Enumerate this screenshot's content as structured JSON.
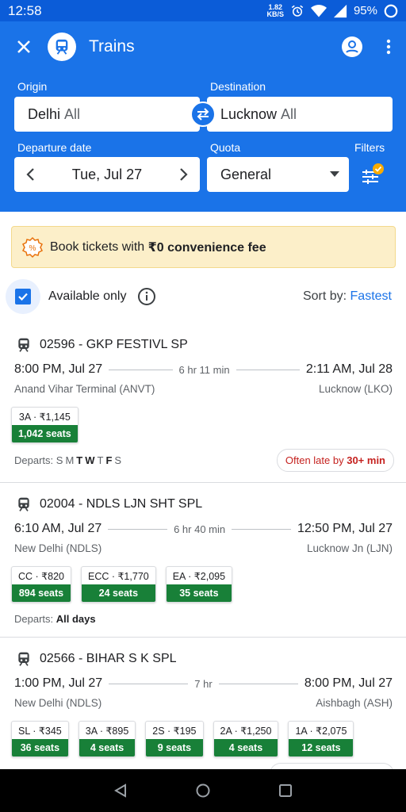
{
  "status_bar": {
    "time": "12:58",
    "net_speed": "1.82",
    "net_unit": "KB/S",
    "battery": "95%"
  },
  "app_bar": {
    "title": "Trains",
    "icons": [
      "close-icon",
      "train-icon",
      "account-icon",
      "more-vert-icon"
    ]
  },
  "search": {
    "origin_label": "Origin",
    "origin_value": "Delhi",
    "origin_suffix": "All",
    "destination_label": "Destination",
    "destination_value": "Lucknow",
    "destination_suffix": "All",
    "date_label": "Departure date",
    "date_value": "Tue, Jul 27",
    "quota_label": "Quota",
    "quota_value": "General",
    "filters_label": "Filters"
  },
  "banner": {
    "prefix": "Book tickets with ",
    "highlight": "₹0 convenience fee"
  },
  "filter_row": {
    "available_only": "Available only",
    "sort_label": "Sort by:",
    "sort_value": "Fastest"
  },
  "trains": [
    {
      "name": "02596 - GKP FESTIVL SP",
      "dep_time": "8:00 PM, Jul 27",
      "duration": "6 hr 11 min",
      "arr_time": "2:11 AM, Jul 28",
      "from": "Anand Vihar Terminal (ANVT)",
      "to": "Lucknow (LKO)",
      "classes": [
        {
          "fare": "3A · ₹1,145",
          "seats": "1,042 seats"
        }
      ],
      "departs_label": "Departs:",
      "days": [
        "S",
        "M",
        "T",
        "W",
        "T",
        "F",
        "S"
      ],
      "late_text": "Often late by ",
      "late_value": "30+ min"
    },
    {
      "name": "02004 - NDLS LJN SHT SPL",
      "dep_time": "6:10 AM, Jul 27",
      "duration": "6 hr 40 min",
      "arr_time": "12:50 PM, Jul 27",
      "from": "New Delhi (NDLS)",
      "to": "Lucknow Jn (LJN)",
      "classes": [
        {
          "fare": "CC · ₹820",
          "seats": "894 seats"
        },
        {
          "fare": "ECC · ₹1,770",
          "seats": "24 seats"
        },
        {
          "fare": "EA · ₹2,095",
          "seats": "35 seats"
        }
      ],
      "departs_label": "Departs:",
      "departs_value": "All days"
    },
    {
      "name": "02566 - BIHAR S K SPL",
      "dep_time": "1:00 PM, Jul 27",
      "duration": "7 hr",
      "arr_time": "8:00 PM, Jul 27",
      "from": "New Delhi (NDLS)",
      "to": "Aishbagh (ASH)",
      "classes": [
        {
          "fare": "SL · ₹345",
          "seats": "36 seats"
        },
        {
          "fare": "3A · ₹895",
          "seats": "4 seats"
        },
        {
          "fare": "2S · ₹195",
          "seats": "9 seats"
        },
        {
          "fare": "2A · ₹1,250",
          "seats": "4 seats"
        },
        {
          "fare": "1A · ₹2,075",
          "seats": "12 seats"
        }
      ]
    }
  ],
  "colors": {
    "primary": "#1a73e8",
    "statusbar": "#0b5cd8",
    "seats_green": "#188038",
    "late_red": "#c5221f",
    "banner_bg": "#fcefc9"
  }
}
